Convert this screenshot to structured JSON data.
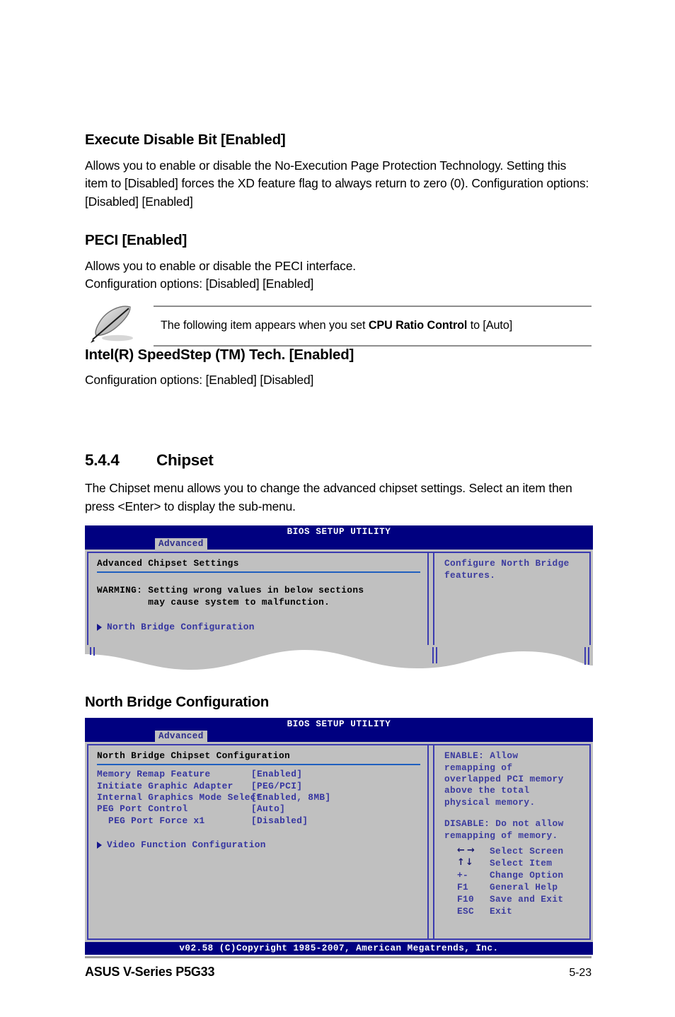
{
  "doc": {
    "sections": [
      {
        "heading": "Execute Disable Bit [Enabled]",
        "paragraph": "Allows you to enable or disable the No-Execution Page Protection Technology. Setting this item to [Disabled] forces the XD feature flag to always return to zero (0). Configuration options: [Disabled] [Enabled]"
      },
      {
        "heading": "PECI [Enabled]",
        "paragraph_line1": "Allows you to enable or disable the PECI interface.",
        "paragraph_line2": "Configuration options: [Disabled] [Enabled]"
      },
      {
        "heading": "Intel(R) SpeedStep (TM) Tech. [Enabled]",
        "paragraph": "Configuration options: [Enabled] [Disabled]"
      }
    ],
    "note": {
      "icon": "feather-icon",
      "text_before": "The following item appears when you set ",
      "text_bold": "CPU Ratio Control",
      "text_after": " to [Auto]"
    },
    "section_544": {
      "number": "5.4.4",
      "title": "Chipset",
      "intro": "The Chipset menu allows you to change the advanced chipset settings. Select an item then press <Enter> to display the sub-menu."
    },
    "subsection": {
      "title": "North Bridge Configuration"
    }
  },
  "bios_screen_1": {
    "title": "BIOS SETUP UTILITY",
    "tab": "Advanced",
    "panel_heading": "Advanced Chipset Settings",
    "warning_line1": "WARMING: Setting wrong values in below sections",
    "warning_line2": "         may cause system to malfunction.",
    "submenu": "North Bridge Configuration",
    "help_line1": "Configure North Bridge",
    "help_line2": "features."
  },
  "bios_screen_2": {
    "title": "BIOS SETUP UTILITY",
    "tab": "Advanced",
    "panel_heading": "North Bridge Chipset Configuration",
    "items": [
      {
        "label": "Memory Remap Feature",
        "value": "[Enabled]"
      },
      {
        "label": "Initiate Graphic Adapter",
        "value": "[PEG/PCI]"
      },
      {
        "label": "Internal Graphics Mode Select",
        "value": "[Enabled, 8MB]"
      },
      {
        "label": "PEG Port Control",
        "value": "[Auto]"
      },
      {
        "label": "  PEG Port Force x1",
        "value": "[Disabled]"
      }
    ],
    "submenu": "Video Function Configuration",
    "help_paragraph_1": "ENABLE: Allow\nremapping of\noverlapped PCI memory\nabove the total\nphysical memory.",
    "help_paragraph_2": "DISABLE: Do not allow\nremapping of memory.",
    "keys": [
      {
        "key": "",
        "icon": "left-right-arrows-icon",
        "desc": "Select Screen"
      },
      {
        "key": "",
        "icon": "up-down-arrows-icon",
        "desc": "Select Item"
      },
      {
        "key": "+-",
        "desc": "Change Option"
      },
      {
        "key": "F1",
        "desc": "General Help"
      },
      {
        "key": "F10",
        "desc": "Save and Exit"
      },
      {
        "key": "ESC",
        "desc": "Exit"
      }
    ],
    "footer": "v02.58 (C)Copyright 1985-2007, American Megatrends, Inc."
  },
  "page_footer": {
    "product": "ASUS V-Series P5G33",
    "page_number": "5-23"
  },
  "colors": {
    "bios_header_blue": "#000080",
    "bios_panel_gray": "#c0c0c0",
    "bios_border_blue": "#3b3bb0",
    "bios_text_blue": "#3535a0",
    "bios_underline_blue": "#1f5fbf"
  }
}
